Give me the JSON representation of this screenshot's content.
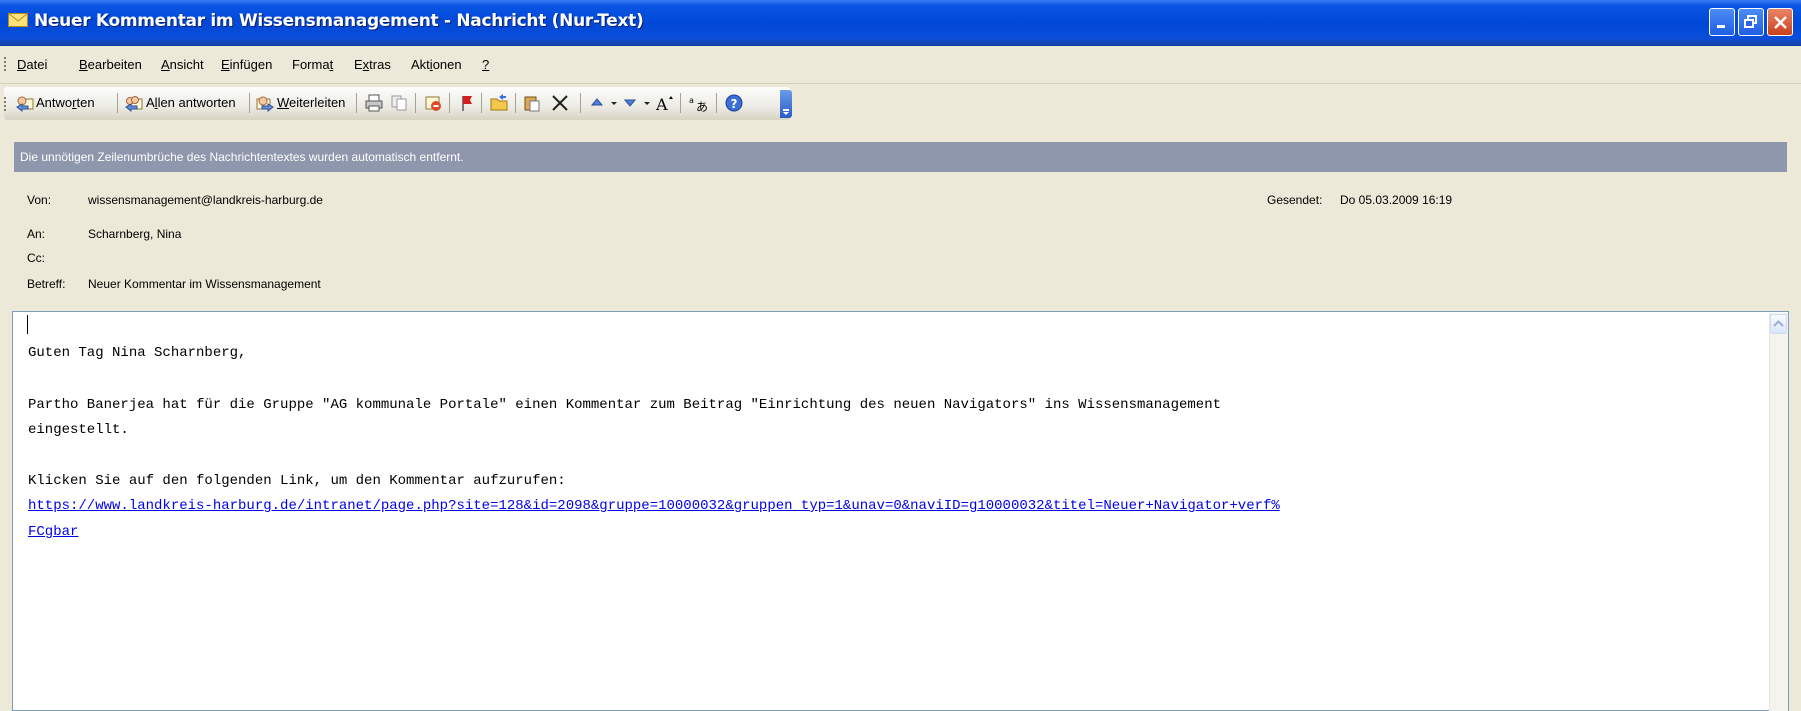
{
  "window": {
    "title": "Neuer Kommentar im Wissensmanagement - Nachricht (Nur-Text)"
  },
  "menu": {
    "items": [
      {
        "pre": "",
        "u": "D",
        "post": "atei"
      },
      {
        "pre": "",
        "u": "B",
        "post": "earbeiten"
      },
      {
        "pre": "",
        "u": "A",
        "post": "nsicht"
      },
      {
        "pre": "",
        "u": "E",
        "post": "infügen"
      },
      {
        "pre": "Forma",
        "u": "t",
        "post": ""
      },
      {
        "pre": "E",
        "u": "x",
        "post": "tras"
      },
      {
        "pre": "Akt",
        "u": "i",
        "post": "onen"
      },
      {
        "pre": "",
        "u": "?",
        "post": ""
      }
    ]
  },
  "toolbar": {
    "reply": {
      "pre": "Antwo",
      "u": "r",
      "post": "ten"
    },
    "reply_all": {
      "pre": "A",
      "u": "l",
      "post": "len antworten"
    },
    "forward": {
      "pre": "",
      "u": "W",
      "post": "eiterleiten"
    },
    "icons": [
      "print-icon",
      "copy-icon",
      "delete-flag-icon",
      "followup-flag-icon",
      "move-folder-icon",
      "paste-icon",
      "delete-x-icon",
      "previous-item-icon",
      "next-item-icon",
      "font-size-icon",
      "encoding-icon",
      "help-icon"
    ]
  },
  "infobar": {
    "text": "Die unnötigen Zeilenumbrüche des Nachrichtentextes wurden automatisch entfernt."
  },
  "header": {
    "from_label": "Von:",
    "from_value": "wissensmanagement@landkreis-harburg.de",
    "to_label": "An:",
    "to_value": "Scharnberg, Nina",
    "cc_label": "Cc:",
    "cc_value": "",
    "subject_label": "Betreff:",
    "subject_value": "Neuer Kommentar im Wissensmanagement",
    "sent_label": "Gesendet:",
    "sent_value": "Do 05.03.2009 16:19"
  },
  "body": {
    "greeting": "Guten Tag Nina Scharnberg,",
    "line1": "Partho Banerjea hat für die Gruppe \"AG kommunale Portale\" einen Kommentar zum Beitrag \"Einrichtung des neuen Navigators\" ins Wissensmanagement",
    "line2": "eingestellt.",
    "line3": "Klicken Sie auf den folgenden Link, um den Kommentar aufzurufen:",
    "link1": "https://www.landkreis-harburg.de/intranet/page.php?site=128&id=2098&gruppe=10000032&gruppen typ=1&unav=0&naviID=g10000032&titel=Neuer+Navigator+verf%",
    "link2": "FCgbar"
  },
  "colors": {
    "titlebar": "#0047d8",
    "infobar": "#8f97ad",
    "link": "#0000ee",
    "chrome": "#ece9d8"
  }
}
